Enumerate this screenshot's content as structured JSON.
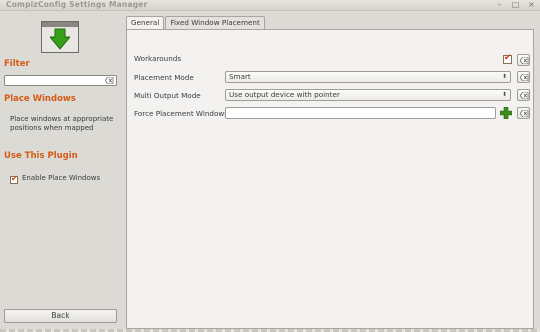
{
  "window": {
    "title": "CompizConfig Settings Manager"
  },
  "sidebar": {
    "filter_heading": "Filter",
    "filter_value": "",
    "place_windows_heading": "Place Windows",
    "description": "Place windows at appropriate positions when mapped",
    "use_plugin_heading": "Use This Plugin",
    "enable_label": "Enable Place Windows",
    "enable_checked": true,
    "back_label": "Back"
  },
  "tabs": [
    {
      "label": "General",
      "active": true
    },
    {
      "label": "Fixed Window Placement",
      "active": false
    }
  ],
  "settings": {
    "workarounds": {
      "label": "Workarounds",
      "checked": true
    },
    "placement_mode": {
      "label": "Placement Mode",
      "value": "Smart"
    },
    "multi_output_mode": {
      "label": "Multi Output Mode",
      "value": "Use output device with pointer"
    },
    "force_placement": {
      "label": "Force Placement Windows",
      "value": ""
    }
  },
  "colors": {
    "accent": "#d55a14",
    "check": "#d0401a",
    "add": "#3d8a1e"
  }
}
